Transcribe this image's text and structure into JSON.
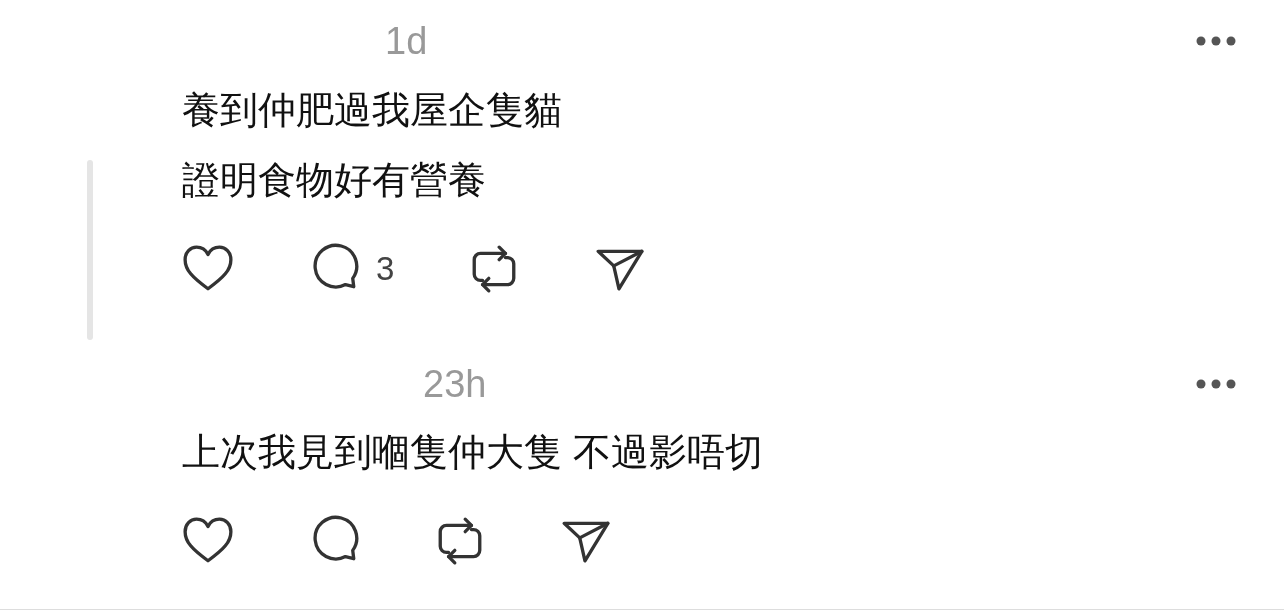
{
  "posts": [
    {
      "time": "1d",
      "text_lines": [
        "養到仲肥過我屋企隻貓",
        "證明食物好有營養"
      ],
      "thread_line": true,
      "liked": false,
      "reply_count": "3"
    },
    {
      "time": "23h",
      "text_lines": [
        "上次我見到嗰隻仲大隻 不過影唔切"
      ],
      "thread_line": false,
      "liked": false
    }
  ]
}
